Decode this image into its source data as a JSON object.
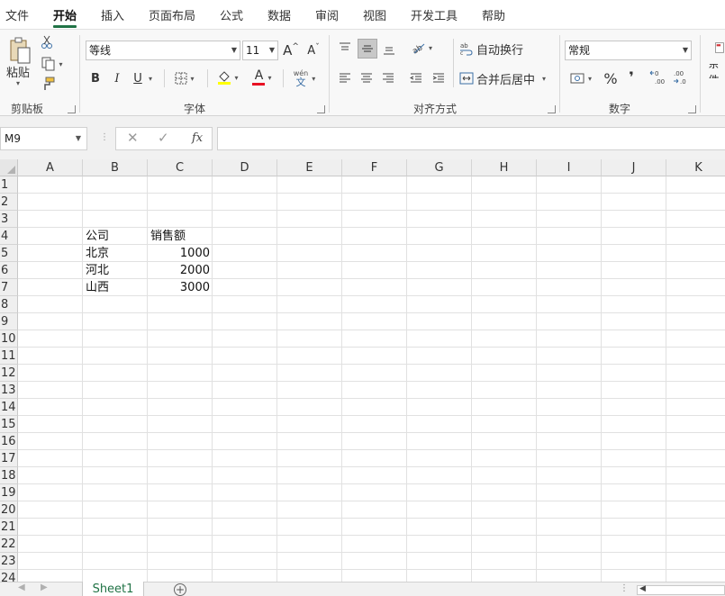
{
  "menu": {
    "items": [
      "文件",
      "开始",
      "插入",
      "页面布局",
      "公式",
      "数据",
      "审阅",
      "视图",
      "开发工具",
      "帮助"
    ],
    "active_index": 1
  },
  "ribbon": {
    "clipboard": {
      "label": "剪贴板",
      "paste_label": "粘贴"
    },
    "font": {
      "label": "字体",
      "font_name": "等线",
      "font_size": "11",
      "bold": "B",
      "italic": "I",
      "underline": "U",
      "grow": "A^",
      "shrink": "Aˇ",
      "font_color": "A",
      "phonetic_top": "wén",
      "phonetic_bottom": "文"
    },
    "alignment": {
      "label": "对齐方式",
      "wrap_text": "自动换行",
      "merge_center": "合并后居中"
    },
    "number": {
      "label": "数字",
      "format": "常规",
      "percent": "%",
      "comma": "❜"
    },
    "styles": {
      "label_partial": "条件"
    }
  },
  "formula_bar": {
    "name_box": "M9",
    "cancel": "✕",
    "enter": "✓",
    "fx": "fx",
    "content": ""
  },
  "grid": {
    "columns": [
      "A",
      "B",
      "C",
      "D",
      "E",
      "F",
      "G",
      "H",
      "I",
      "J",
      "K"
    ],
    "rows": [
      "1",
      "2",
      "3",
      "4",
      "5",
      "6",
      "7",
      "8",
      "9",
      "10",
      "11",
      "12",
      "13",
      "14",
      "15",
      "16",
      "17",
      "18",
      "19",
      "20",
      "21",
      "22",
      "23",
      "24"
    ],
    "cells": [
      {
        "ref": "B4",
        "value": "公司",
        "align": "left"
      },
      {
        "ref": "C4",
        "value": "销售额",
        "align": "left"
      },
      {
        "ref": "B5",
        "value": "北京",
        "align": "left"
      },
      {
        "ref": "C5",
        "value": "1000",
        "align": "right"
      },
      {
        "ref": "B6",
        "value": "河北",
        "align": "left"
      },
      {
        "ref": "C6",
        "value": "2000",
        "align": "right"
      },
      {
        "ref": "B7",
        "value": "山西",
        "align": "left"
      },
      {
        "ref": "C7",
        "value": "3000",
        "align": "right"
      }
    ]
  },
  "sheets": {
    "tabs": [
      "Sheet1"
    ],
    "add_label": "+",
    "dots": "⋮"
  },
  "colors": {
    "accent": "#217346",
    "font_color_bar": "#e81123",
    "fill_color_bar": "#ffff00"
  }
}
